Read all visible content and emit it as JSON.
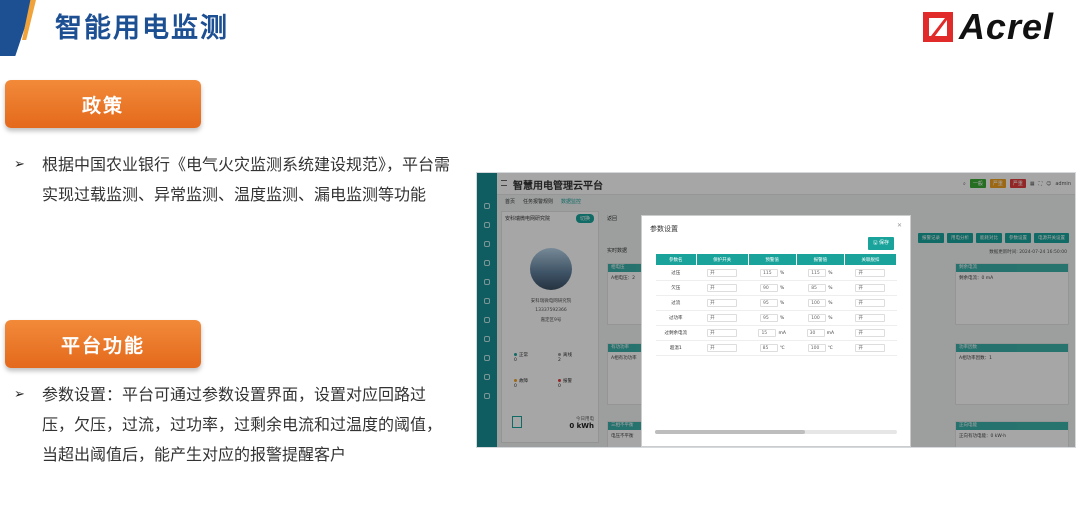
{
  "slide": {
    "title": "智能用电监测",
    "logo_text": "Acrel",
    "policy": {
      "label": "政策",
      "bullet": "根据中国农业银行《电气火灾监测系统建设规范》，平台需实现过载监测、异常监测、温度监测、漏电监测等功能"
    },
    "platform": {
      "label": "平台功能",
      "bullet": "参数设置：平台可通过参数设置界面，设置对应回路过压，欠压，过流，过功率，过剩余电流和过温度的阈值，当超出阈值后，能产生对应的报警提醒客户"
    }
  },
  "app": {
    "title": "智慧用电管理云平台",
    "user": "admin",
    "tags": [
      {
        "text": "一般",
        "color": "#3aaa35"
      },
      {
        "text": "严重",
        "color": "#f0a020"
      },
      {
        "text": "严重",
        "color": "#e23b3b"
      }
    ],
    "tabs": [
      "首页",
      "任务报警规则",
      "数据监控"
    ],
    "left": {
      "header": "安科瑞微电网研究院",
      "switch_btn": "切换",
      "org_name": "安科瑞微电网研究院",
      "phone": "13337592366",
      "address": "嘉定区9号",
      "stats": [
        {
          "label": "正常",
          "value": "0",
          "color": "#1aa39b"
        },
        {
          "label": "离线",
          "value": "2",
          "color": "#999999"
        },
        {
          "label": "故障",
          "value": "0",
          "color": "#f0a020"
        },
        {
          "label": "报警",
          "value": "0",
          "color": "#e23b3b"
        }
      ],
      "today_label": "今日用电",
      "today_value": "0 kWh"
    },
    "main": {
      "back": "返回",
      "realtime": "实时数据",
      "update_time": "数据更新时间: 2024-07-24 16:50:00",
      "buttons": [
        "报警记录",
        "用电分析",
        "能耗对比",
        "参数设置",
        "电源开关设置"
      ],
      "blocks": [
        {
          "title": "相电压",
          "body": "A相电压：2"
        },
        {
          "title": "剩余电流",
          "body": "剩余电流：0 mA"
        },
        {
          "title": "有功功率",
          "body": "A相有功功率"
        },
        {
          "title": "功率因数",
          "body": "A相功率因数：1"
        },
        {
          "title": "三相不平衡",
          "body": "电压不平衡"
        },
        {
          "title": "正向电能",
          "body": "正向有功电能：0 kW·h"
        }
      ]
    },
    "modal": {
      "title": "参数设置",
      "save": "保存",
      "headers": [
        "参数名",
        "保护开关",
        "预警值",
        "报警值",
        "关联脱扣"
      ],
      "rows": [
        {
          "name": "过压",
          "switch": "开",
          "warn": "115",
          "warn_unit": "%",
          "alarm": "115",
          "alarm_unit": "%",
          "trip": "开"
        },
        {
          "name": "欠压",
          "switch": "开",
          "warn": "90",
          "warn_unit": "%",
          "alarm": "85",
          "alarm_unit": "%",
          "trip": "开"
        },
        {
          "name": "过流",
          "switch": "开",
          "warn": "95",
          "warn_unit": "%",
          "alarm": "100",
          "alarm_unit": "%",
          "trip": "开"
        },
        {
          "name": "过功率",
          "switch": "开",
          "warn": "95",
          "warn_unit": "%",
          "alarm": "100",
          "alarm_unit": "%",
          "trip": "开"
        },
        {
          "name": "过剩余电流",
          "switch": "开",
          "warn": "15",
          "warn_unit": "mA",
          "alarm": "30",
          "alarm_unit": "mA",
          "trip": "开"
        },
        {
          "name": "超温1",
          "switch": "开",
          "warn": "85",
          "warn_unit": "℃",
          "alarm": "100",
          "alarm_unit": "℃",
          "trip": "开"
        }
      ]
    }
  }
}
